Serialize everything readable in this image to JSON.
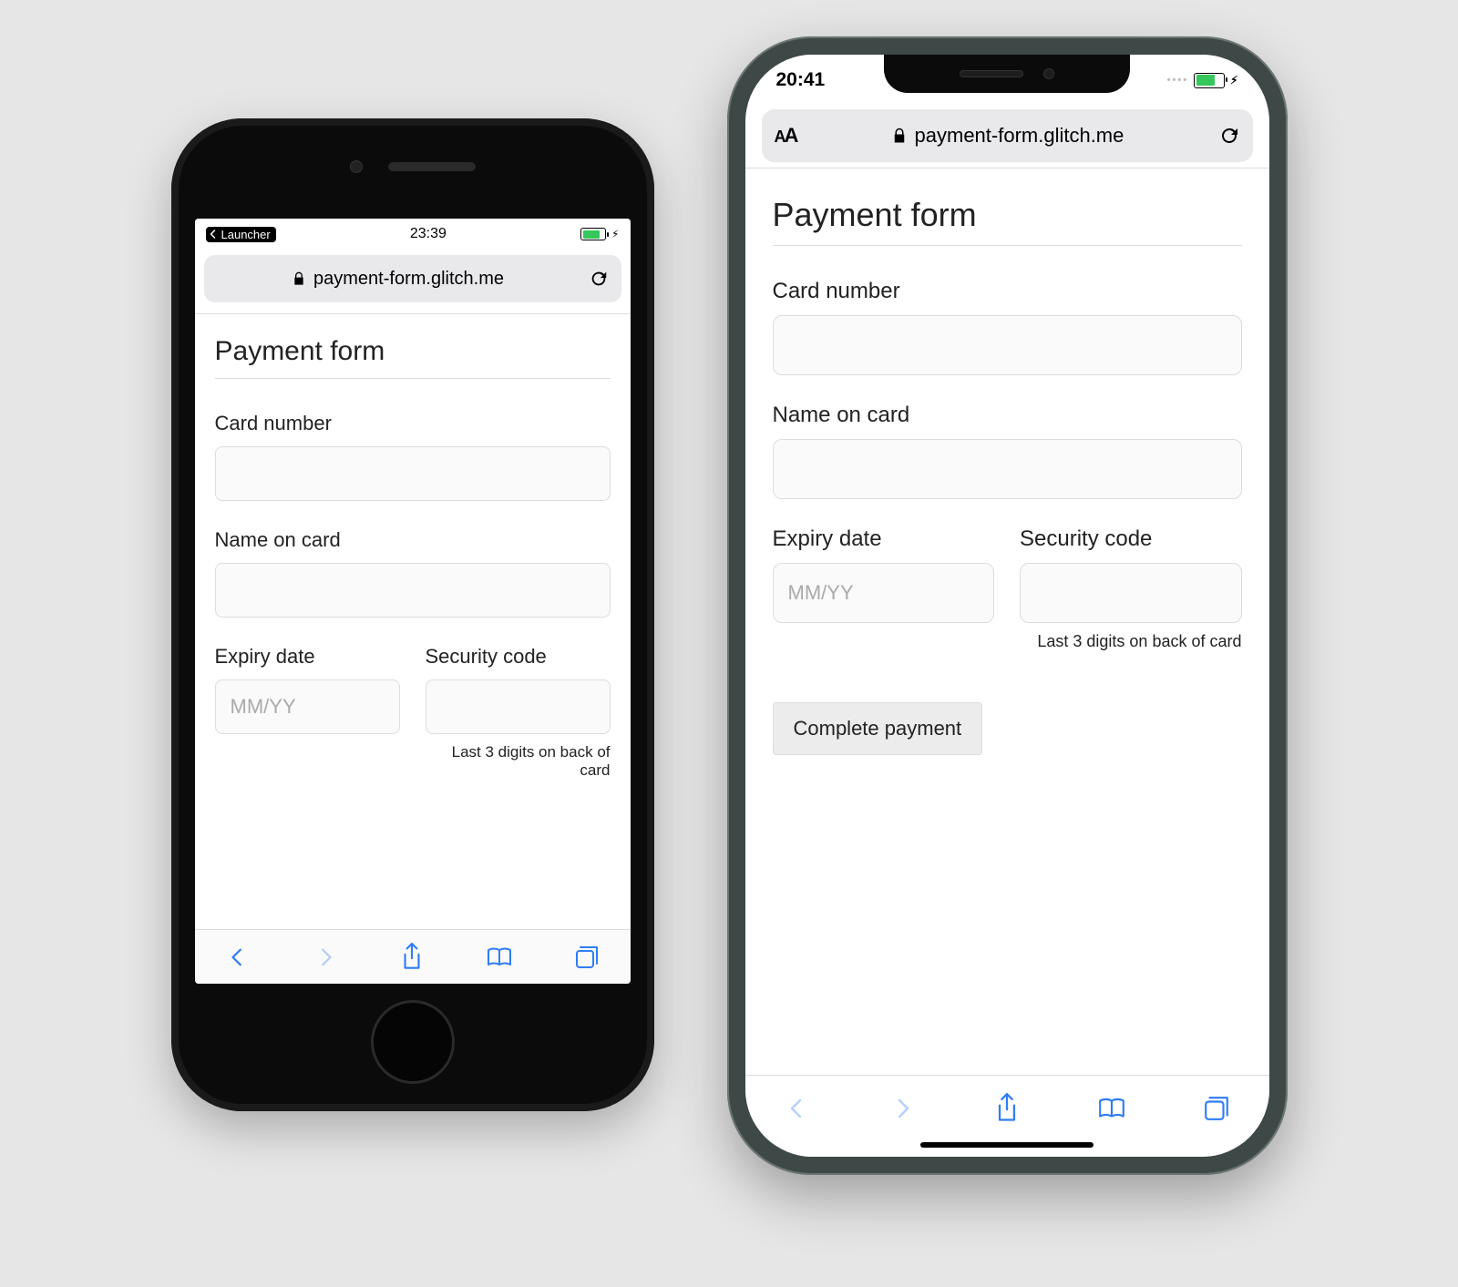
{
  "phone_a": {
    "status": {
      "back_app": "Launcher",
      "time": "23:39"
    },
    "url_bar": {
      "address": "payment-form.glitch.me"
    },
    "page": {
      "title": "Payment form",
      "card_number_label": "Card number",
      "name_label": "Name on card",
      "expiry_label": "Expiry date",
      "expiry_placeholder": "MM/YY",
      "cvc_label": "Security code",
      "cvc_hint": "Last 3 digits on back of card"
    }
  },
  "phone_b": {
    "status": {
      "time": "20:41"
    },
    "url_bar": {
      "address": "payment-form.glitch.me"
    },
    "page": {
      "title": "Payment form",
      "card_number_label": "Card number",
      "name_label": "Name on card",
      "expiry_label": "Expiry date",
      "expiry_placeholder": "MM/YY",
      "cvc_label": "Security code",
      "cvc_hint": "Last 3 digits on back of card",
      "submit_label": "Complete payment"
    }
  }
}
